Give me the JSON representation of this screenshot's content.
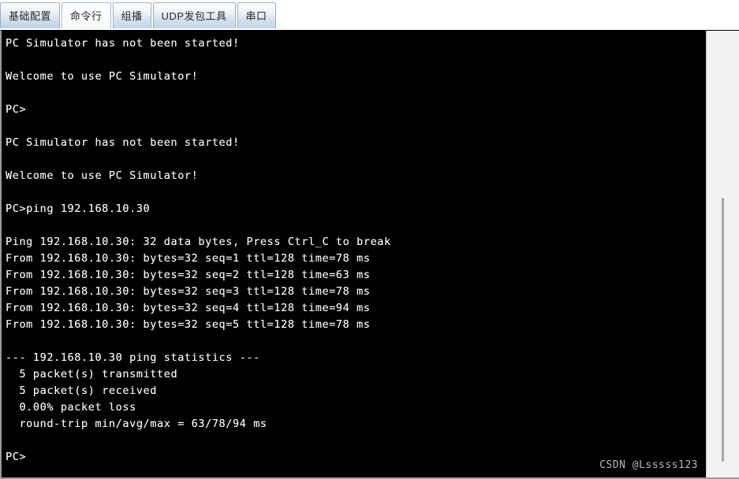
{
  "tabbar": {
    "tabs": [
      {
        "label": "基础配置",
        "selected": false
      },
      {
        "label": "命令行",
        "selected": true
      },
      {
        "label": "组播",
        "selected": false
      },
      {
        "label": "UDP发包工具",
        "selected": false
      },
      {
        "label": "串口",
        "selected": false
      }
    ]
  },
  "terminal": {
    "background_color": "#000000",
    "text_color": "#f4f4f4",
    "lines": [
      "PC Simulator has not been started!",
      "",
      "Welcome to use PC Simulator!",
      "",
      "PC>",
      "",
      "PC Simulator has not been started!",
      "",
      "Welcome to use PC Simulator!",
      "",
      "PC>ping 192.168.10.30",
      "",
      "Ping 192.168.10.30: 32 data bytes, Press Ctrl_C to break",
      "From 192.168.10.30: bytes=32 seq=1 ttl=128 time=78 ms",
      "From 192.168.10.30: bytes=32 seq=2 ttl=128 time=63 ms",
      "From 192.168.10.30: bytes=32 seq=3 ttl=128 time=78 ms",
      "From 192.168.10.30: bytes=32 seq=4 ttl=128 time=94 ms",
      "From 192.168.10.30: bytes=32 seq=5 ttl=128 time=78 ms",
      "",
      "--- 192.168.10.30 ping statistics ---",
      "  5 packet(s) transmitted",
      "  5 packet(s) received",
      "  0.00% packet loss",
      "  round-trip min/avg/max = 63/78/94 ms",
      "",
      "PC>"
    ]
  },
  "scrollbar": {
    "orientation": "vertical"
  },
  "watermark": {
    "text": "CSDN @Lsssss123"
  }
}
